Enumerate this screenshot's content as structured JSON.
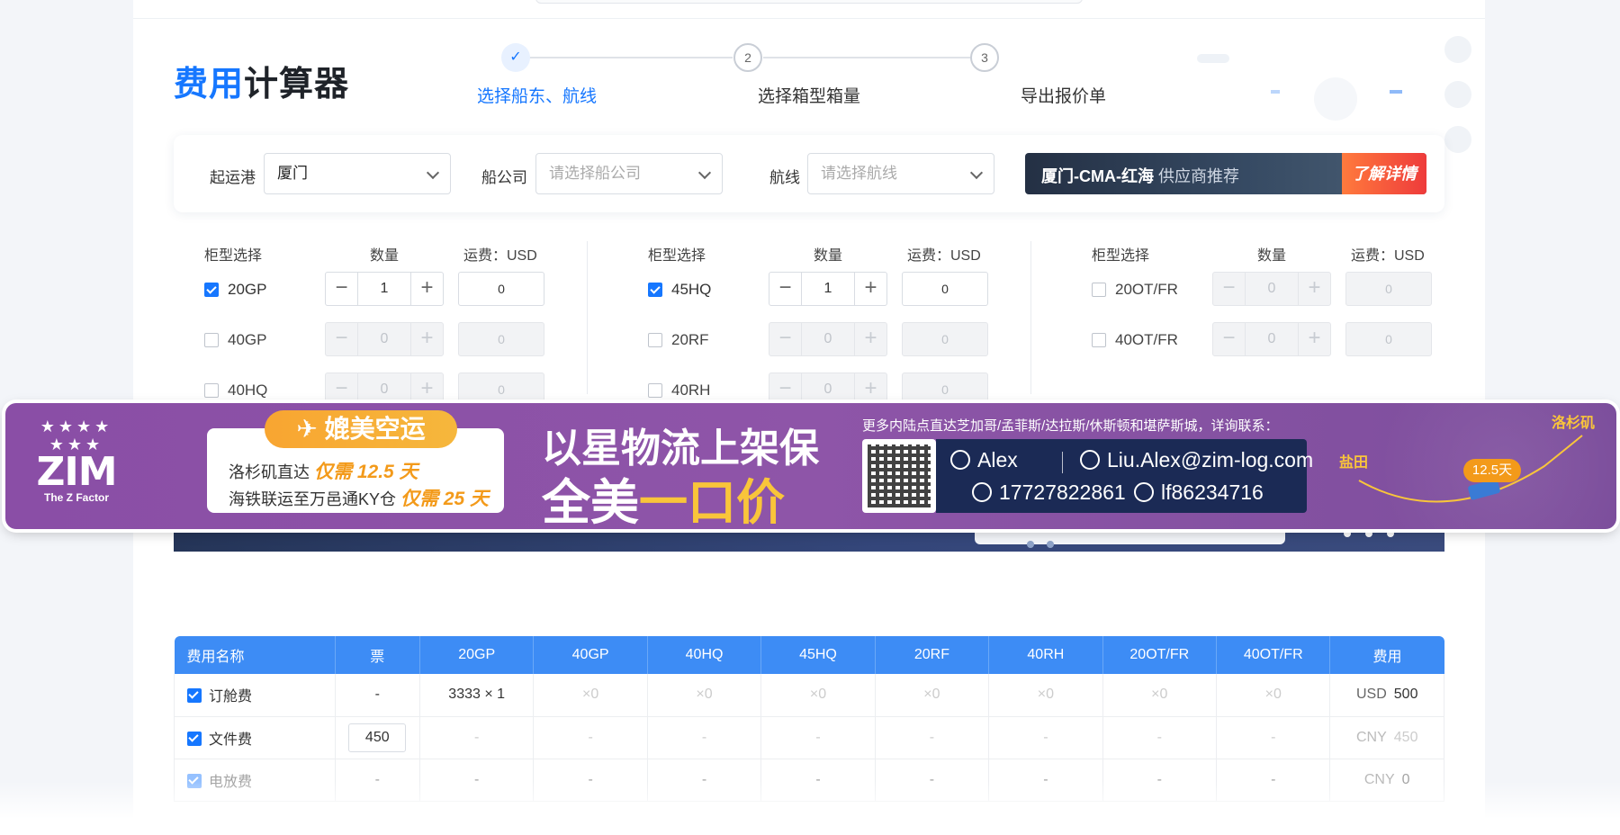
{
  "header": {
    "title_highlight": "费用",
    "title_rest": "计算器"
  },
  "stepper": {
    "steps": [
      {
        "number": "✓",
        "label": "选择船东、航线",
        "state": "done"
      },
      {
        "number": "2",
        "label": "选择箱型箱量",
        "state": "todo"
      },
      {
        "number": "3",
        "label": "导出报价单",
        "state": "todo"
      }
    ]
  },
  "filters": {
    "origin_label": "起运港",
    "origin_value": "厦门",
    "carrier_label": "船公司",
    "carrier_placeholder": "请选择船公司",
    "route_label": "航线",
    "route_placeholder": "请选择航线",
    "promo_route": "厦门-CMA-红海",
    "promo_text": "供应商推荐",
    "promo_button": "了解详情"
  },
  "container_table": {
    "col_type": "柜型选择",
    "col_qty": "数量",
    "col_fee": "运费：USD",
    "groups": [
      {
        "rows": [
          {
            "name": "20GP",
            "checked": true,
            "qty": "1",
            "fee": "0"
          },
          {
            "name": "40GP",
            "checked": false,
            "qty": "0",
            "fee": "0"
          },
          {
            "name": "40HQ",
            "checked": false,
            "qty": "0",
            "fee": "0"
          }
        ]
      },
      {
        "rows": [
          {
            "name": "45HQ",
            "checked": true,
            "qty": "1",
            "fee": "0"
          },
          {
            "name": "20RF",
            "checked": false,
            "qty": "0",
            "fee": "0"
          },
          {
            "name": "40RH",
            "checked": false,
            "qty": "0",
            "fee": "0"
          }
        ]
      },
      {
        "rows": [
          {
            "name": "20OT/FR",
            "checked": false,
            "qty": "0",
            "fee": "0"
          },
          {
            "name": "40OT/FR",
            "checked": false,
            "qty": "0",
            "fee": "0"
          }
        ]
      }
    ],
    "minus": "−",
    "plus": "+"
  },
  "banner": {
    "logo_stars": "★★★★\n★★★",
    "logo_word": "ZIM",
    "logo_sub": "The Z Factor",
    "air_tag": "✈ 媲美空运",
    "air_line1_a": "洛杉矶直达",
    "air_line1_b": "仅需 12.5 天",
    "air_line2_a": "海铁联运至万邑通KY仓",
    "air_line2_b": "仅需 25 天",
    "slogan_line1": "以星物流上架保",
    "slogan_line2_a": "全美",
    "slogan_line2_b": "一口价",
    "contact_intro": "更多内陆点直达芝加哥/孟菲斯/达拉斯/休斯顿和堪萨斯城，详询联系：",
    "contact_name": "Alex",
    "contact_email": "Liu.Alex@zim-log.com",
    "contact_phone": "17727822861",
    "contact_wechat": "lf86234716",
    "map_origin": "盐田",
    "map_dest": "洛杉矶",
    "map_days": "12.5天"
  },
  "fee_table": {
    "headers": [
      "费用名称",
      "票",
      "20GP",
      "40GP",
      "40HQ",
      "45HQ",
      "20RF",
      "40RH",
      "20OT/FR",
      "40OT/FR",
      "费用"
    ],
    "rows": [
      {
        "name": "订舱费",
        "ticket": "-",
        "cells": [
          "3333 × 1",
          "×0",
          "×0",
          "×0",
          "×0",
          "×0",
          "×0",
          "×0"
        ],
        "currency": "USD",
        "amount": "500"
      },
      {
        "name": "文件费",
        "ticket": "450",
        "cells": [
          "-",
          "-",
          "-",
          "-",
          "-",
          "-",
          "-",
          "-"
        ],
        "currency": "CNY",
        "amount": "450"
      },
      {
        "name": "电放费",
        "ticket": "-",
        "cells": [
          "-",
          "-",
          "-",
          "-",
          "-",
          "-",
          "-",
          "-"
        ],
        "currency": "CNY",
        "amount": "0"
      }
    ]
  },
  "colors": {
    "accent": "#1677ff",
    "table_header": "#3d8cf5",
    "banner_purple": "#8a4ea6",
    "banner_yellow": "#f9c53a",
    "air_orange": "#f39a1a"
  }
}
